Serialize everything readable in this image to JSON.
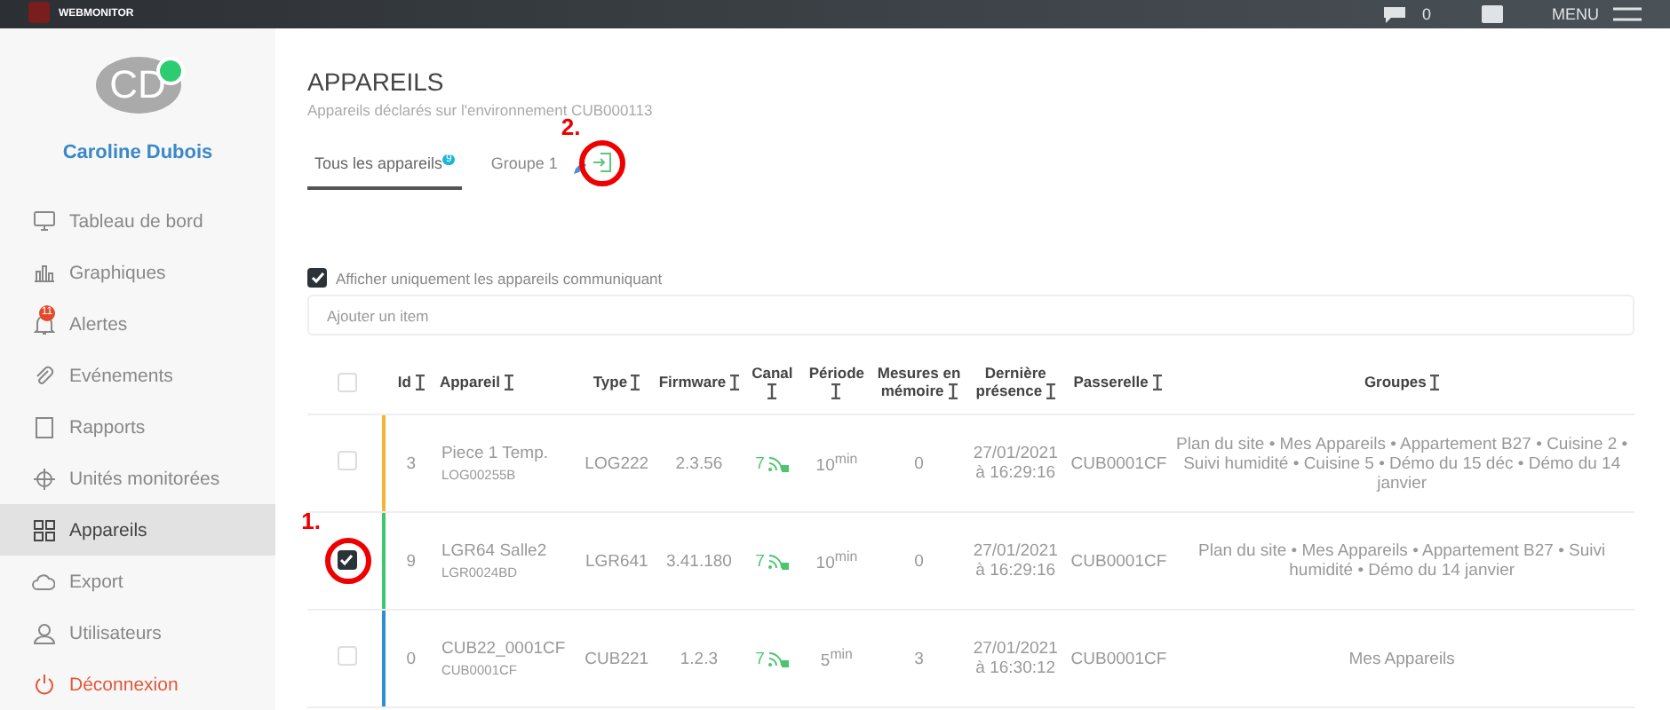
{
  "top_bar": {
    "logo_subtitle": "WEBMONITOR",
    "messages_count": "0",
    "menu_label": "MENU"
  },
  "user": {
    "initials": "CD",
    "name": "Caroline Dubois",
    "online": true
  },
  "sidebar": {
    "items": [
      {
        "label": "Tableau de bord",
        "selected": false,
        "kind": "normal"
      },
      {
        "label": "Graphiques",
        "selected": false,
        "kind": "normal"
      },
      {
        "label": "Alertes",
        "selected": false,
        "kind": "normal",
        "badge": "11"
      },
      {
        "label": "Evénements",
        "selected": false,
        "kind": "normal"
      },
      {
        "label": "Rapports",
        "selected": false,
        "kind": "normal"
      },
      {
        "label": "Unités monitorées",
        "selected": false,
        "kind": "normal"
      },
      {
        "label": "Appareils",
        "selected": true,
        "kind": "normal"
      },
      {
        "label": "Export",
        "selected": false,
        "kind": "normal"
      },
      {
        "label": "Utilisateurs",
        "selected": false,
        "kind": "normal"
      },
      {
        "label": "Déconnexion",
        "selected": false,
        "kind": "logout"
      }
    ]
  },
  "page": {
    "title": "APPAREILS",
    "subtitle": "Appareils déclarés sur l'environnement CUB000113"
  },
  "tabs": [
    {
      "label": "Tous les appareils",
      "badge": "9",
      "selected": true,
      "editable": false
    },
    {
      "label": "Groupe 1",
      "selected": false,
      "editable": true,
      "annotation": "2."
    }
  ],
  "filter": {
    "label": "Afficher uniquement les appareils communiquant",
    "checked": true
  },
  "search": {
    "placeholder": "Ajouter un item"
  },
  "table": {
    "select_all_checked": false,
    "columns": [
      "Id",
      "Appareil",
      "Type",
      "Firmware",
      "Canal",
      "Période",
      "Mesures en mémoire",
      "Dernière présence",
      "Passerelle",
      "Groupes"
    ],
    "rows": [
      {
        "checked": false,
        "color": "#f5b335",
        "id": "3",
        "name": "Piece 1 Temp.",
        "serial": "LOG00255B",
        "type": "LOG222",
        "firmware": "2.3.56",
        "channel": "7",
        "period": "10$^{min}$",
        "measures": "0",
        "last_seen": "27/01/2021 à 16:29:16",
        "gateway": "CUB0001CF",
        "groups": "Plan du site • Mes Appareils • Appartement B27 • Cuisine 2 • Suivi humidité • Cuisine 5 • Démo du 15 déc • Démo du 14 janvier"
      },
      {
        "checked": true,
        "annotation": "1.",
        "color": "#3cc86e",
        "id": "9",
        "name": "LGR64 Salle2",
        "serial": "LGR0024BD",
        "type": "LGR641",
        "firmware": "3.41.180",
        "channel": "7",
        "period": "10$^{min}$",
        "measures": "0",
        "last_seen": "27/01/2021 à 16:29:16",
        "gateway": "CUB0001CF",
        "groups": "Plan du site • Mes Appareils • Appartement B27 • Suivi humidité • Démo du 14 janvier"
      },
      {
        "checked": false,
        "color": "#2d8fd8",
        "id": "0",
        "name": "CUB22_0001CF",
        "serial": "CUB0001CF",
        "type": "CUB221",
        "firmware": "1.2.3",
        "channel": "7",
        "period": "5$^{min}$",
        "measures": "3",
        "last_seen": "27/01/2021 à 16:30:12",
        "gateway": "CUB0001CF",
        "groups": "Mes Appareils"
      }
    ]
  }
}
